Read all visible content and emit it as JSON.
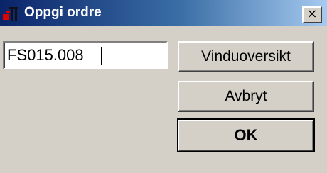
{
  "window": {
    "title": "Oppgi ordre",
    "close_symbol": "×",
    "icon": "app-icon"
  },
  "form": {
    "order_value": "FS015.008"
  },
  "buttons": {
    "overview_label": "Vinduoversikt",
    "cancel_label": "Avbryt",
    "ok_label": "OK"
  },
  "colors": {
    "titlebar_start": "#0a246a",
    "titlebar_end": "#a6caf0",
    "face": "#d4d0c8"
  }
}
